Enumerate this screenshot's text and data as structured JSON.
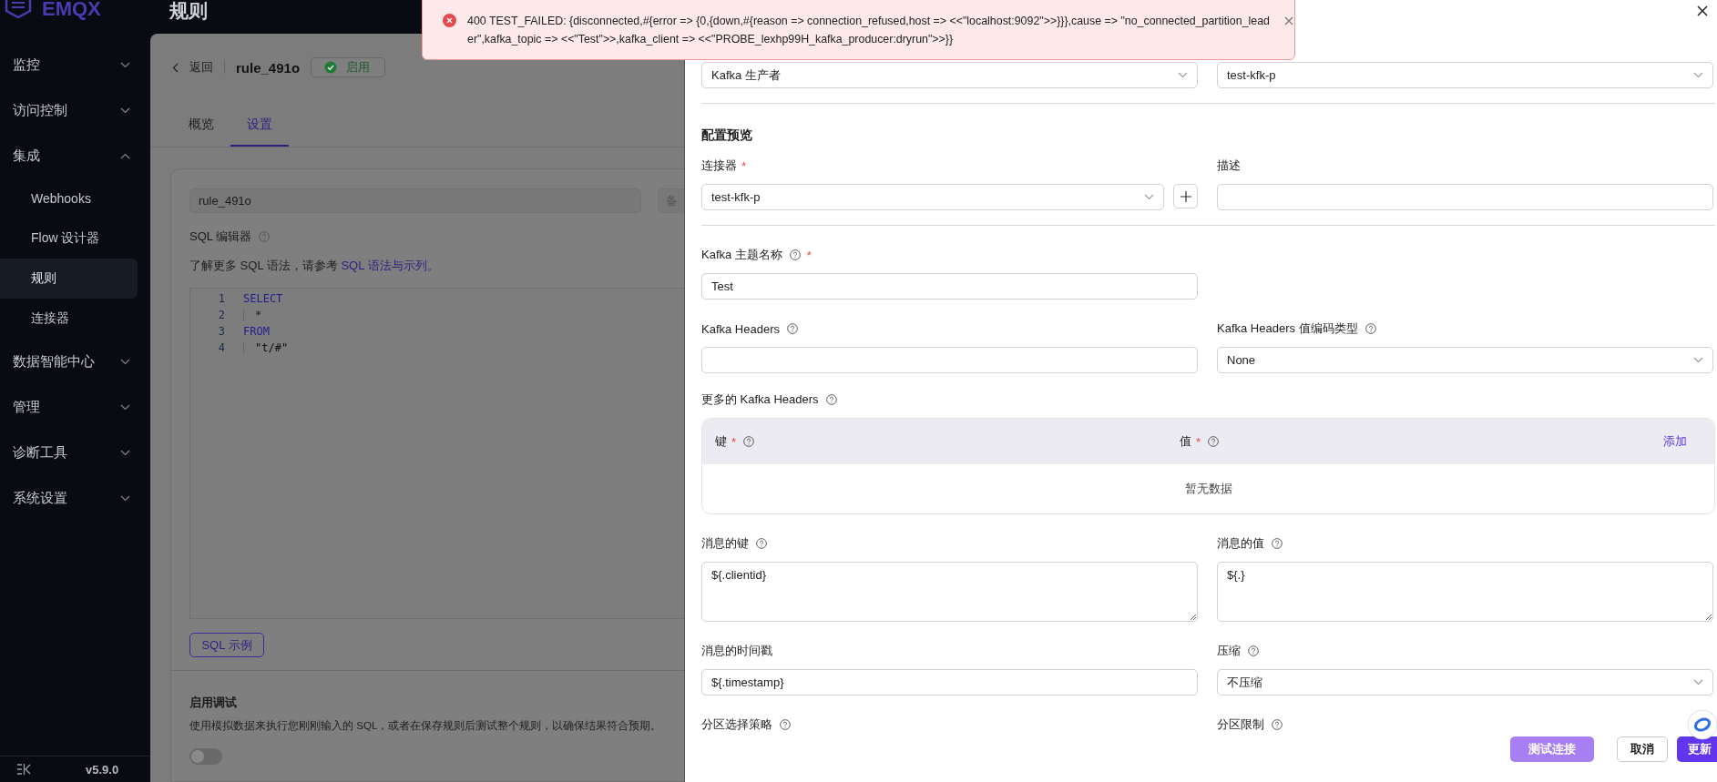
{
  "app": {
    "logo": "EMQX",
    "page_title": "规则",
    "version": "v5.9.0"
  },
  "sidebar": {
    "items": [
      {
        "label": "监控",
        "expanded": false
      },
      {
        "label": "访问控制",
        "expanded": false
      },
      {
        "label": "集成",
        "expanded": true,
        "children": [
          {
            "label": "Webhooks",
            "selected": false
          },
          {
            "label": "Flow 设计器",
            "selected": false
          },
          {
            "label": "规则",
            "selected": true
          },
          {
            "label": "连接器",
            "selected": false
          }
        ]
      },
      {
        "label": "数据智能中心",
        "expanded": false
      },
      {
        "label": "管理",
        "expanded": false
      },
      {
        "label": "诊断工具",
        "expanded": false
      },
      {
        "label": "系统设置",
        "expanded": false
      }
    ]
  },
  "rule": {
    "back": "返回",
    "name": "rule_491o",
    "status": {
      "label": "启用",
      "enabled": true
    }
  },
  "tabs": [
    {
      "label": "概览",
      "selected": false
    },
    {
      "label": "设置",
      "selected": true
    }
  ],
  "settings": {
    "name_value": "rule_491o",
    "note_placeholder": "备",
    "sql_label": "SQL 编辑器",
    "sql_hint": "了解更多 SQL 语法，请参考 ",
    "sql_link": "SQL 语法与示列。",
    "code": [
      {
        "number": "1",
        "text": "SELECT",
        "kind": "keyword"
      },
      {
        "number": "2",
        "text": "*",
        "kind": "plain"
      },
      {
        "number": "3",
        "text": "FROM",
        "kind": "keyword"
      },
      {
        "number": "4",
        "text": "\"t/#\"",
        "kind": "string"
      }
    ],
    "example_button": "SQL 示例",
    "debug": {
      "title": "启用调试",
      "description": "使用模拟数据来执行您刚刚输入的 SQL，或者在保存规则后测试整个规则，以确保结果符合预期。",
      "on": false
    }
  },
  "toast": {
    "kind": "error",
    "message": "400 TEST_FAILED: {disconnected,#{error => {0,{down,#{reason => connection_refused,host => <<\"localhost:9092\">>}}},cause => \"no_connected_partition_leader\",kafka_topic => <<\"Test\">>,kafka_client => <<\"PROBE_lexhp99H_kafka_producer:dryrun\">>}}"
  },
  "drawer": {
    "blocks": [
      {
        "kind": "fields",
        "fields": [
          {
            "kind": "select",
            "value": "Kafka 生产者"
          },
          {
            "kind": "select",
            "value": "test-kfk-p"
          }
        ]
      },
      {
        "kind": "divider"
      },
      {
        "kind": "heading",
        "text": "配置预览"
      },
      {
        "kind": "fields",
        "fields": [
          {
            "kind": "select-add",
            "label": "连接器",
            "required": true,
            "help": false,
            "value": "test-kfk-p"
          },
          {
            "kind": "input",
            "label": "描述",
            "required": false,
            "help": false
          }
        ]
      },
      {
        "kind": "divider"
      },
      {
        "kind": "fields",
        "fields": [
          {
            "kind": "input",
            "label": "Kafka 主题名称",
            "required": true,
            "help": true,
            "value": "Test"
          }
        ]
      },
      {
        "kind": "fields",
        "fields": [
          {
            "kind": "input",
            "label": "Kafka Headers",
            "required": false,
            "help": true
          },
          {
            "kind": "select",
            "label": "Kafka Headers 值编码类型",
            "required": false,
            "help": true,
            "value": "None"
          }
        ]
      },
      {
        "kind": "table",
        "label": "更多的 Kafka Headers",
        "help": true,
        "columns": [
          {
            "label": "键",
            "required": true,
            "help": true
          },
          {
            "label": "值",
            "required": true,
            "help": true
          }
        ],
        "action": "添加",
        "empty": "暂无数据"
      },
      {
        "kind": "fields",
        "fields": [
          {
            "kind": "textarea",
            "label": "消息的键",
            "required": false,
            "help": true,
            "value": "${.clientid}"
          },
          {
            "kind": "textarea",
            "label": "消息的值",
            "required": false,
            "help": true,
            "value": "${.}"
          }
        ]
      },
      {
        "kind": "fields",
        "fields": [
          {
            "kind": "input",
            "label": "消息的时间戳",
            "required": false,
            "help": false,
            "value": "${.timestamp}"
          },
          {
            "kind": "select",
            "label": "压缩",
            "required": false,
            "help": true,
            "value": "不压缩"
          }
        ]
      },
      {
        "kind": "fields",
        "fields": [
          {
            "kind": "label",
            "label": "分区选择策略",
            "required": false,
            "help": true
          },
          {
            "kind": "label",
            "label": "分区限制",
            "required": false,
            "help": true
          }
        ]
      }
    ],
    "buttons": [
      {
        "label": "测试连接",
        "kind": "secondary"
      },
      {
        "label": "取消",
        "kind": "plain"
      },
      {
        "label": "更新",
        "kind": "primary"
      }
    ]
  }
}
